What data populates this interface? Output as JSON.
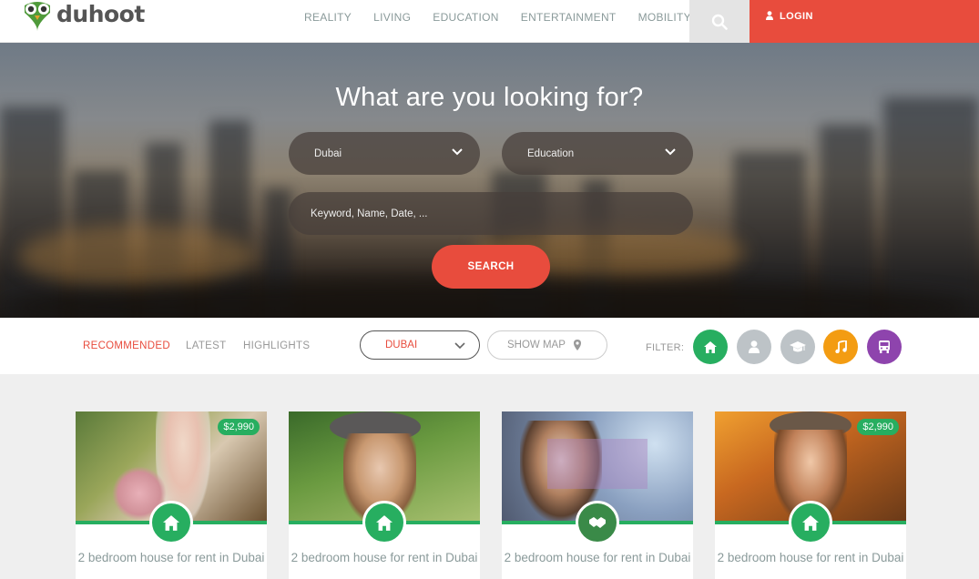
{
  "header": {
    "logo_text": "duhoot",
    "nav": [
      "REALITY",
      "LIVING",
      "EDUCATION",
      "ENTERTAINMENT",
      "MOBILITY"
    ],
    "search_icon": "search-icon",
    "login_label": "LOGIN"
  },
  "hero": {
    "title": "What are you looking for?",
    "location_select": "Dubai",
    "category_select": "Education",
    "keyword_placeholder": "Keyword, Name, Date, ...",
    "search_label": "SEARCH"
  },
  "filterbar": {
    "tabs": [
      {
        "label": "RECOMMENDED",
        "active": true
      },
      {
        "label": "LATEST",
        "active": false
      },
      {
        "label": "HIGHLIGHTS",
        "active": false
      }
    ],
    "city_dropdown": "DUBAI",
    "show_map_label": "SHOW MAP",
    "filter_label": "FILTER:",
    "filters": [
      {
        "icon": "home-icon",
        "color": "#27ae60"
      },
      {
        "icon": "person-icon",
        "color": "#bdc3c7"
      },
      {
        "icon": "graduation-cap-icon",
        "color": "#bdc3c7"
      },
      {
        "icon": "music-icon",
        "color": "#f39c12"
      },
      {
        "icon": "bus-icon",
        "color": "#8e44ad"
      }
    ]
  },
  "cards": [
    {
      "title": "2 bedroom house for rent in Dubai",
      "price": "$2,990",
      "icon": "home-icon",
      "icon_color": "#27ae60"
    },
    {
      "title": "2 bedroom house for rent in Dubai",
      "price": "",
      "icon": "home-icon",
      "icon_color": "#27ae60"
    },
    {
      "title": "2 bedroom house for rent in Dubai",
      "price": "",
      "icon": "handshake-icon",
      "icon_color": "#3a8a48"
    },
    {
      "title": "2 bedroom house for rent in Dubai",
      "price": "$2,990",
      "icon": "home-icon",
      "icon_color": "#27ae60"
    }
  ],
  "colors": {
    "accent": "#e84c3d",
    "green": "#27ae60"
  }
}
